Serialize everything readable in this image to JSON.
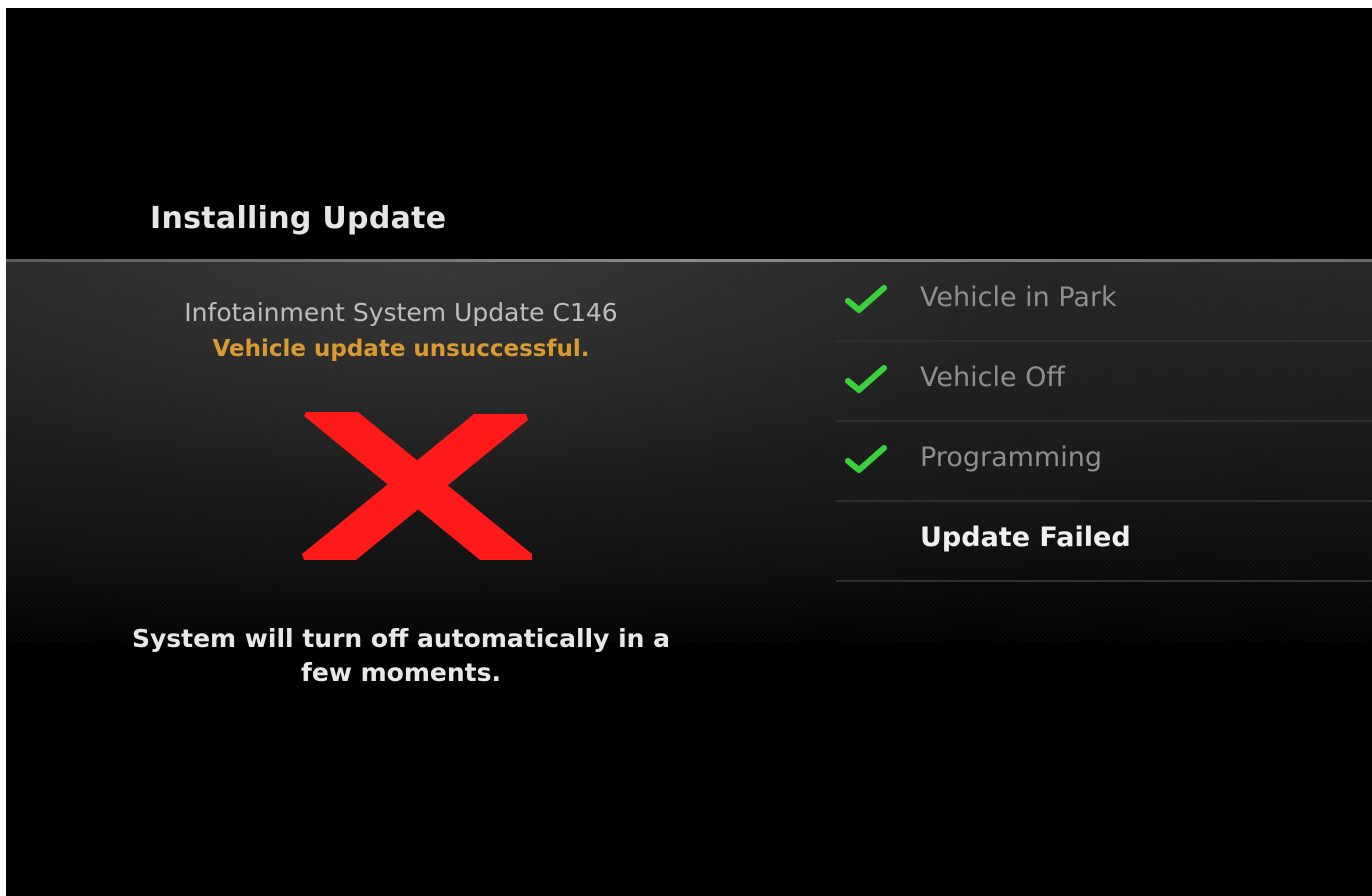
{
  "header": {
    "title": "Installing Update"
  },
  "update": {
    "system_name": "Infotainment System Update C146",
    "status_message": "Vehicle update unsuccessful.",
    "result_icon": "red-x-icon",
    "shutdown_message_line1": "System will turn off automatically in a",
    "shutdown_message_line2": "few moments."
  },
  "checklist": {
    "steps": [
      {
        "label": "Vehicle in Park",
        "completed": true,
        "icon": "checkmark-icon"
      },
      {
        "label": "Vehicle Off",
        "completed": true,
        "icon": "checkmark-icon"
      },
      {
        "label": "Programming",
        "completed": true,
        "icon": "checkmark-icon"
      },
      {
        "label": "Update Failed",
        "completed": false,
        "current": true
      }
    ]
  },
  "colors": {
    "background": "#000000",
    "status_warning": "#d99a2f",
    "error_red": "#ff1a1a",
    "check_green": "#37d23c",
    "text_primary": "#e8e8e8",
    "text_muted": "#8e8e8e"
  }
}
